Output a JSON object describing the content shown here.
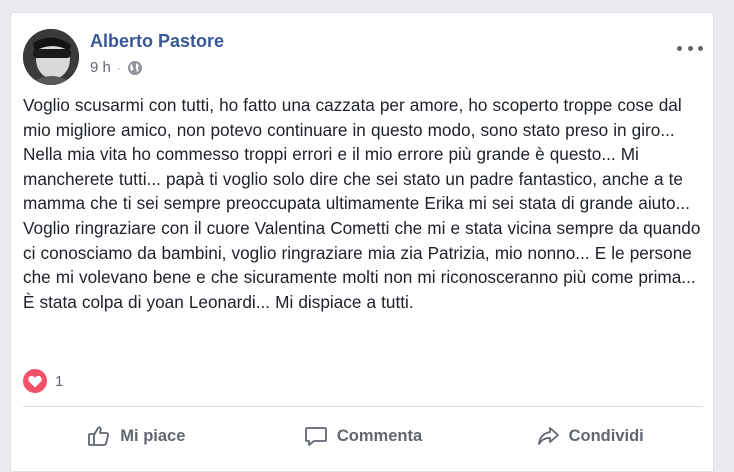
{
  "post": {
    "author_name": "Alberto Pastore",
    "timestamp": "9 h",
    "separator": "·",
    "privacy_icon": "globe-icon",
    "options_icon": "more-options-icon",
    "message": "Voglio scusarmi con tutti, ho fatto una cazzata per amore, ho scoperto troppe cose dal mio migliore amico, non potevo continuare in questo modo, sono stato preso in giro... Nella mia vita ho commesso troppi errori e il mio errore più grande è questo... Mi mancherete tutti... papà ti voglio solo dire che sei stato un padre fantastico, anche a te mamma che ti sei sempre preoccupata ultimamente Erika mi sei stata di grande aiuto... Voglio ringraziare con il cuore Valentina Cometti che mi e stata vicina sempre da quando ci conosciamo da bambini, voglio ringraziare mia zia Patrizia, mio nonno... E le persone che mi volevano bene e che sicuramente molti non mi riconosceranno più come prima... È stata colpa di yoan Leonardi... Mi dispiace a tutti."
  },
  "reactions": {
    "icon": "love-reaction-icon",
    "count": "1",
    "color": "#f25268"
  },
  "actions": {
    "like_label": "Mi piace",
    "comment_label": "Commenta",
    "share_label": "Condividi"
  },
  "colors": {
    "author_link": "#385898",
    "meta_text": "#616770",
    "body_text": "#1d2129",
    "action_text": "#606770",
    "page_background": "#e9ebee"
  }
}
